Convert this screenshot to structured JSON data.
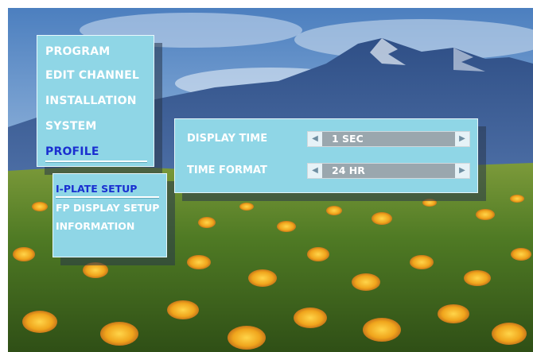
{
  "main_menu": {
    "items": [
      {
        "label": "PROGRAM"
      },
      {
        "label": "EDIT CHANNEL"
      },
      {
        "label": "INSTALLATION"
      },
      {
        "label": "SYSTEM"
      },
      {
        "label": "PROFILE",
        "selected": true
      }
    ]
  },
  "sub_menu": {
    "items": [
      {
        "label": "I-PLATE SETUP",
        "selected": true
      },
      {
        "label": "FP DISPLAY SETUP"
      },
      {
        "label": "INFORMATION"
      }
    ]
  },
  "settings": {
    "display_time": {
      "label": "DISPLAY TIME",
      "value": "1 SEC"
    },
    "time_format": {
      "label": "TIME FORMAT",
      "value": "24 HR"
    }
  },
  "icons": {
    "left_arrow": "triangle-left-icon",
    "right_arrow": "triangle-right-icon"
  },
  "colors": {
    "panel": "#8fd6e6",
    "selected_text": "#1a2fd0",
    "text": "#ffffff",
    "selector": "#9aa7ae"
  }
}
